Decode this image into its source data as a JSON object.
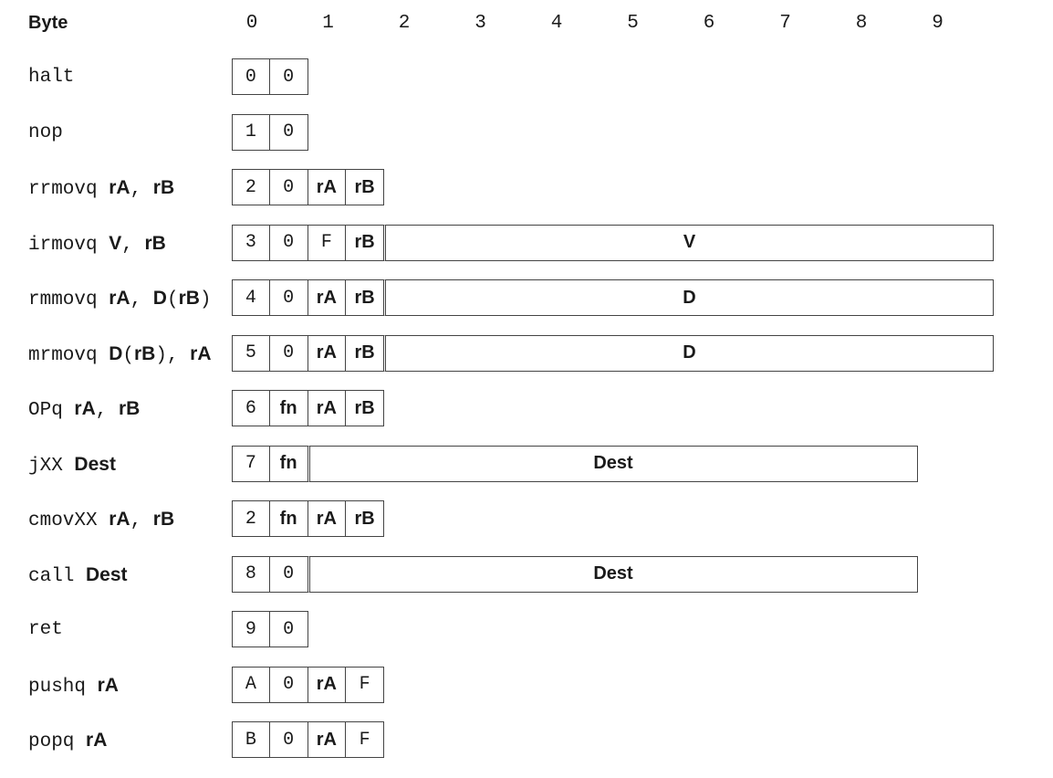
{
  "header": {
    "label": "Byte",
    "indices": [
      "0",
      "1",
      "2",
      "3",
      "4",
      "5",
      "6",
      "7",
      "8",
      "9"
    ]
  },
  "instructions": [
    {
      "label": [
        {
          "text": "halt",
          "style": "mono"
        }
      ],
      "fields": [
        {
          "text": "0",
          "bytes": 0.5,
          "style": "mono"
        },
        {
          "text": "0",
          "bytes": 0.5,
          "style": "mono"
        }
      ]
    },
    {
      "label": [
        {
          "text": "nop",
          "style": "mono"
        }
      ],
      "fields": [
        {
          "text": "1",
          "bytes": 0.5,
          "style": "mono"
        },
        {
          "text": "0",
          "bytes": 0.5,
          "style": "mono"
        }
      ]
    },
    {
      "label": [
        {
          "text": "rrmovq ",
          "style": "mono"
        },
        {
          "text": "rA",
          "style": "bold"
        },
        {
          "text": ", ",
          "style": "mono"
        },
        {
          "text": "rB",
          "style": "bold"
        }
      ],
      "fields": [
        {
          "text": "2",
          "bytes": 0.5,
          "style": "mono"
        },
        {
          "text": "0",
          "bytes": 0.5,
          "style": "mono"
        },
        {
          "text": "rA",
          "bytes": 0.5,
          "style": "bold"
        },
        {
          "text": "rB",
          "bytes": 0.5,
          "style": "bold"
        }
      ]
    },
    {
      "label": [
        {
          "text": "irmovq ",
          "style": "mono"
        },
        {
          "text": "V",
          "style": "bold"
        },
        {
          "text": ", ",
          "style": "mono"
        },
        {
          "text": "rB",
          "style": "bold"
        }
      ],
      "fields": [
        {
          "text": "3",
          "bytes": 0.5,
          "style": "mono"
        },
        {
          "text": "0",
          "bytes": 0.5,
          "style": "mono"
        },
        {
          "text": "F",
          "bytes": 0.5,
          "style": "mono"
        },
        {
          "text": "rB",
          "bytes": 0.5,
          "style": "bold"
        },
        {
          "text": "V",
          "bytes": 8,
          "style": "bold"
        }
      ]
    },
    {
      "label": [
        {
          "text": "rmmovq ",
          "style": "mono"
        },
        {
          "text": "rA",
          "style": "bold"
        },
        {
          "text": ", ",
          "style": "mono"
        },
        {
          "text": "D",
          "style": "bold"
        },
        {
          "text": "(",
          "style": "mono"
        },
        {
          "text": "rB",
          "style": "bold"
        },
        {
          "text": ")",
          "style": "mono"
        }
      ],
      "fields": [
        {
          "text": "4",
          "bytes": 0.5,
          "style": "mono"
        },
        {
          "text": "0",
          "bytes": 0.5,
          "style": "mono"
        },
        {
          "text": "rA",
          "bytes": 0.5,
          "style": "bold"
        },
        {
          "text": "rB",
          "bytes": 0.5,
          "style": "bold"
        },
        {
          "text": "D",
          "bytes": 8,
          "style": "bold"
        }
      ]
    },
    {
      "label": [
        {
          "text": "mrmovq ",
          "style": "mono"
        },
        {
          "text": "D",
          "style": "bold"
        },
        {
          "text": "(",
          "style": "mono"
        },
        {
          "text": "rB",
          "style": "bold"
        },
        {
          "text": "), ",
          "style": "mono"
        },
        {
          "text": "rA",
          "style": "bold"
        }
      ],
      "fields": [
        {
          "text": "5",
          "bytes": 0.5,
          "style": "mono"
        },
        {
          "text": "0",
          "bytes": 0.5,
          "style": "mono"
        },
        {
          "text": "rA",
          "bytes": 0.5,
          "style": "bold"
        },
        {
          "text": "rB",
          "bytes": 0.5,
          "style": "bold"
        },
        {
          "text": "D",
          "bytes": 8,
          "style": "bold"
        }
      ]
    },
    {
      "label": [
        {
          "text": "OPq ",
          "style": "mono"
        },
        {
          "text": "rA",
          "style": "bold"
        },
        {
          "text": ", ",
          "style": "mono"
        },
        {
          "text": "rB",
          "style": "bold"
        }
      ],
      "fields": [
        {
          "text": "6",
          "bytes": 0.5,
          "style": "mono"
        },
        {
          "text": "fn",
          "bytes": 0.5,
          "style": "bold"
        },
        {
          "text": "rA",
          "bytes": 0.5,
          "style": "bold"
        },
        {
          "text": "rB",
          "bytes": 0.5,
          "style": "bold"
        }
      ]
    },
    {
      "label": [
        {
          "text": "jXX ",
          "style": "mono"
        },
        {
          "text": "Dest",
          "style": "bold"
        }
      ],
      "fields": [
        {
          "text": "7",
          "bytes": 0.5,
          "style": "mono"
        },
        {
          "text": "fn",
          "bytes": 0.5,
          "style": "bold"
        },
        {
          "text": "Dest",
          "bytes": 8,
          "style": "bold"
        }
      ]
    },
    {
      "label": [
        {
          "text": "cmovXX ",
          "style": "mono"
        },
        {
          "text": "rA",
          "style": "bold"
        },
        {
          "text": ", ",
          "style": "mono"
        },
        {
          "text": "rB",
          "style": "bold"
        }
      ],
      "fields": [
        {
          "text": "2",
          "bytes": 0.5,
          "style": "mono"
        },
        {
          "text": "fn",
          "bytes": 0.5,
          "style": "bold"
        },
        {
          "text": "rA",
          "bytes": 0.5,
          "style": "bold"
        },
        {
          "text": "rB",
          "bytes": 0.5,
          "style": "bold"
        }
      ]
    },
    {
      "label": [
        {
          "text": "call ",
          "style": "mono"
        },
        {
          "text": "Dest",
          "style": "bold"
        }
      ],
      "fields": [
        {
          "text": "8",
          "bytes": 0.5,
          "style": "mono"
        },
        {
          "text": "0",
          "bytes": 0.5,
          "style": "mono"
        },
        {
          "text": "Dest",
          "bytes": 8,
          "style": "bold"
        }
      ]
    },
    {
      "label": [
        {
          "text": "ret",
          "style": "mono"
        }
      ],
      "fields": [
        {
          "text": "9",
          "bytes": 0.5,
          "style": "mono"
        },
        {
          "text": "0",
          "bytes": 0.5,
          "style": "mono"
        }
      ]
    },
    {
      "label": [
        {
          "text": "pushq ",
          "style": "mono"
        },
        {
          "text": "rA",
          "style": "bold"
        }
      ],
      "fields": [
        {
          "text": "A",
          "bytes": 0.5,
          "style": "mono"
        },
        {
          "text": "0",
          "bytes": 0.5,
          "style": "mono"
        },
        {
          "text": "rA",
          "bytes": 0.5,
          "style": "bold"
        },
        {
          "text": "F",
          "bytes": 0.5,
          "style": "mono"
        }
      ]
    },
    {
      "label": [
        {
          "text": "popq ",
          "style": "mono"
        },
        {
          "text": "rA",
          "style": "bold"
        }
      ],
      "fields": [
        {
          "text": "B",
          "bytes": 0.5,
          "style": "mono"
        },
        {
          "text": "0",
          "bytes": 0.5,
          "style": "mono"
        },
        {
          "text": "rA",
          "bytes": 0.5,
          "style": "bold"
        },
        {
          "text": "F",
          "bytes": 0.5,
          "style": "mono"
        }
      ]
    }
  ]
}
